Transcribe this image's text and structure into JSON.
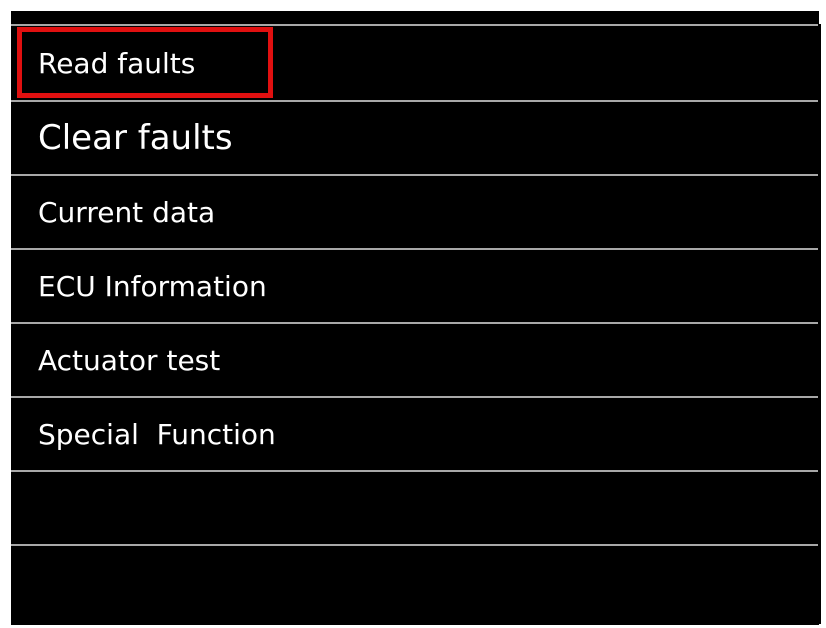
{
  "menu": {
    "items": [
      {
        "label": "Read faults"
      },
      {
        "label": "Clear faults"
      },
      {
        "label": "Current data"
      },
      {
        "label": "ECU Information"
      },
      {
        "label": "Actuator test"
      },
      {
        "label": "Special  Function"
      },
      {
        "label": ""
      },
      {
        "label": ""
      }
    ],
    "selected_item": "Read faults"
  },
  "colors": {
    "background": "#000000",
    "text": "#ffffff",
    "divider": "#a8a8a8",
    "highlight": "#e01010"
  }
}
